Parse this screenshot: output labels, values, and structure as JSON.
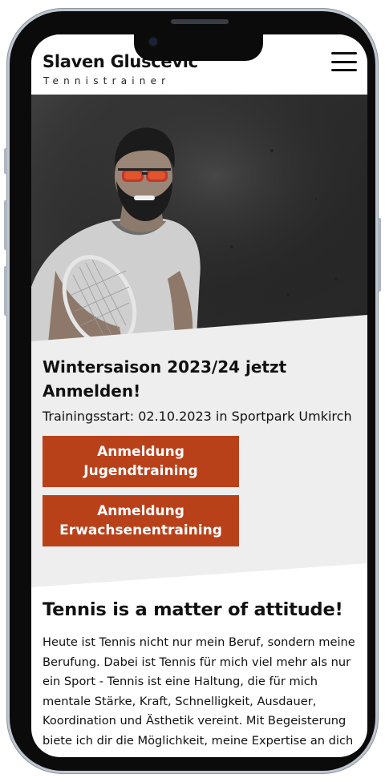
{
  "header": {
    "brand_name": "Slaven Gluscevic",
    "brand_tagline": "Tennistrainer",
    "menu_icon": "hamburger-menu-icon"
  },
  "hero": {
    "image": "photo of tennis coach with sunglasses holding a racket"
  },
  "promo": {
    "title": "Wintersaison 2023/24 jetzt Anmelden!",
    "subtitle": "Trainingsstart: 02.10.2023 in Sportpark Umkirch",
    "button_youth": "Anmeldung Jugendtraining",
    "button_adult": "Anmeldung Erwachsenentraining"
  },
  "about": {
    "title": "Tennis is a matter of attitude!",
    "text": "Heute ist Tennis nicht nur mein Beruf, sondern meine Berufung. Dabei ist Tennis für mich viel mehr als nur ein Sport - Tennis ist eine Haltung, die für mich mentale Stärke, Kraft, Schnelligkeit, Ausdauer, Koordination und Ästhetik vereint. Mit Begeisterung biete ich dir die Möglichkeit, meine Expertise an dich"
  },
  "colors": {
    "accent": "#b9411a",
    "section_bg": "#eeeeef",
    "text": "#111111"
  }
}
